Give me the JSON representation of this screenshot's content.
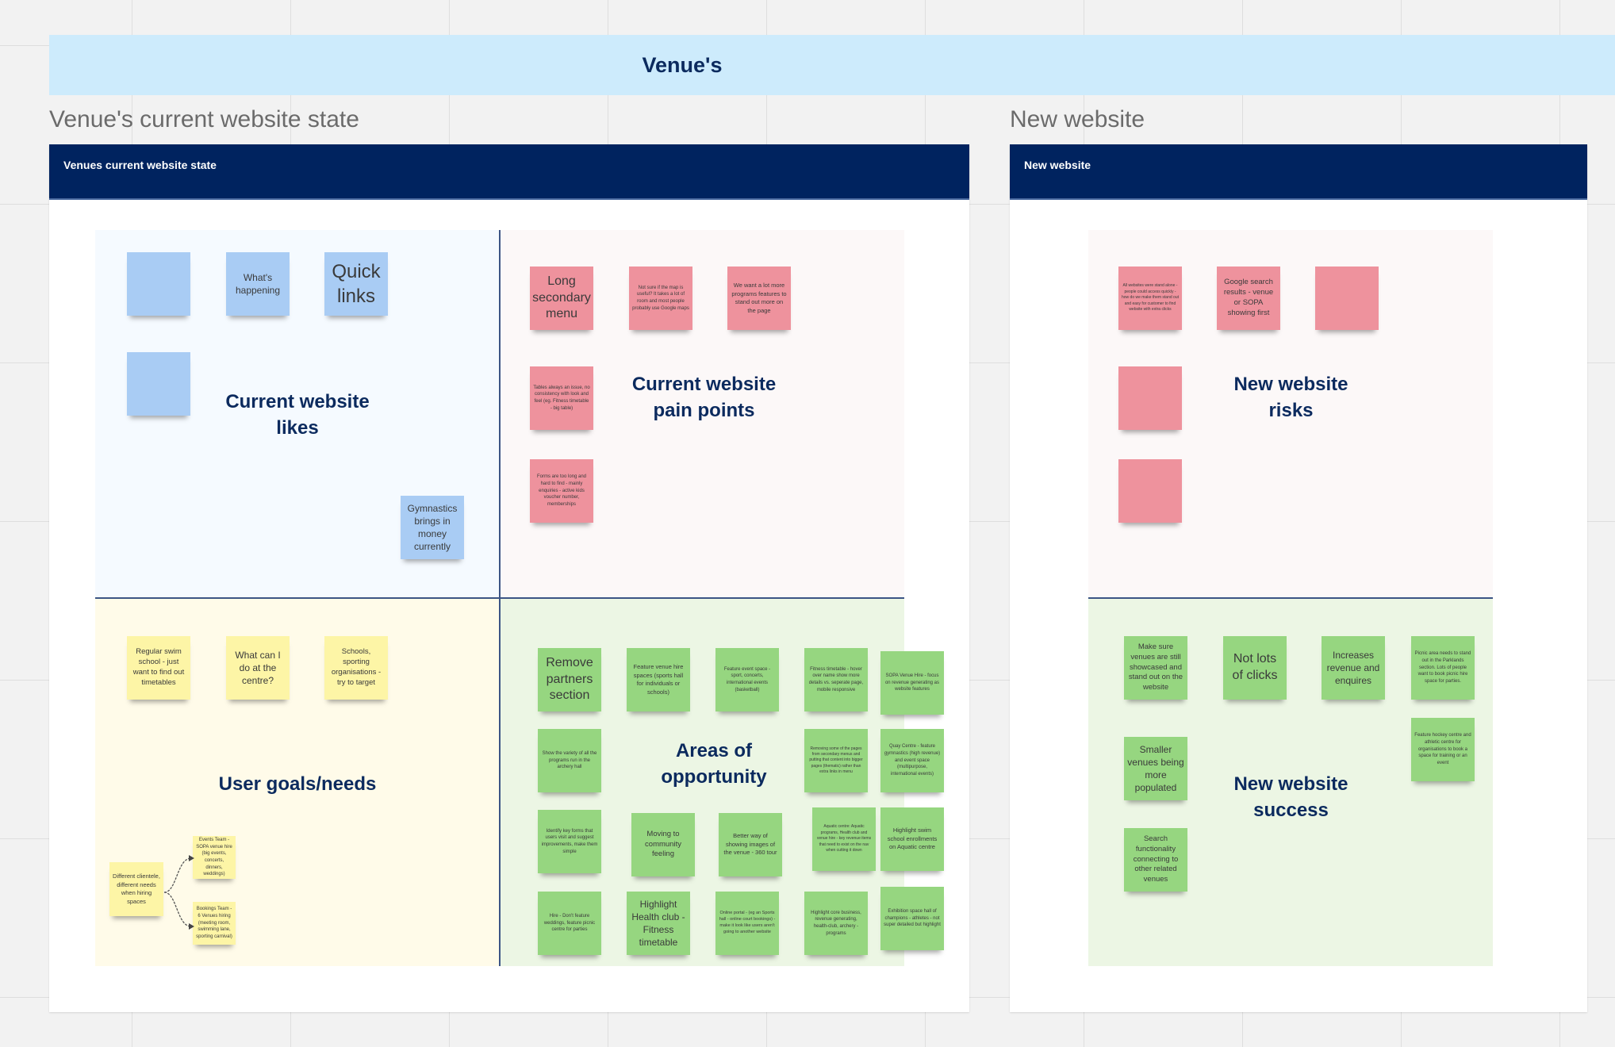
{
  "banner": {
    "title": "Venue's"
  },
  "colors": {
    "banner": "#cdebfc",
    "frame_header": "#00235f",
    "label_text": "#0b2a5e",
    "sticky_blue": "#a9ccf4",
    "sticky_pink": "#ee929d",
    "sticky_yellow": "#fdf5a6",
    "sticky_green": "#96d680"
  },
  "current_frame": {
    "title": "Venue's current website state",
    "header_label": "Venues current website state",
    "quadrants": {
      "likes": {
        "label": "Current website likes",
        "stickies": [
          "",
          "What's happening",
          "Quick links",
          "",
          "Gymnastics brings in money currently"
        ]
      },
      "pain_points": {
        "label": "Current website pain points",
        "stickies": [
          "Long secondary menu",
          "Not sure if the map is useful? It takes a lot of room and most people probably use Google maps",
          "We want a lot more programs features to stand out more on the page",
          "Tables always an issue, no consistency with look and feel (eg. Fitness timetable - big table)",
          "Forms are too long and hard to find - mainly enquiries - active kids voucher number, memberships"
        ]
      },
      "user_goals": {
        "label": "User goals/needs",
        "stickies": [
          "Regular swim school - just want to find out timetables",
          "What can I do at the centre?",
          "Schools, sporting organisations - try to target",
          "Different clientele, different needs when hiring spaces",
          "Events Team - SOPA venue hire (big events, concerts, dinners, weddings)",
          "Bookings Team - 6 Venues hiring (meeting room, swimming lane, sporting carnival)"
        ]
      },
      "opportunities": {
        "label": "Areas of opportunity",
        "stickies": [
          "Remove partners section",
          "Feature venue hire spaces (sports hall for individuals or schools)",
          "Feature event space - sport, concerts, international events (basketball)",
          "Fitness timetable - hover over name show more details vs. seperate page, mobile responsive",
          "SOPA Venue Hire - focus on revenue generating as website features",
          "Show the variety of all the programs run in the archery hall",
          "Removing some of the pages from secondary menus and putting that content into bigger pages (thematic) rather than extra links in menu",
          "Quay Centre - feature gymnastics (high revenue) and event space (multipurpose, international events)",
          "Identify key forms that users visit and suggest improvements, make them simple",
          "Moving to community feeling",
          "Better way of showing images of the venue - 360 tour",
          "Aquatic centre: Aquatic programs, Health club and venue hire - key revenue items that need to exist on the nav when cutting it down",
          "Highlight swim school enrollments on Aquatic centre",
          "Hire - Don't feature weddings, feature picnic centre for parties",
          "Highlight Health club - Fitness timetable",
          "Online portal - (eg an Sports hall - online court bookings) - make it look like users aren't going to another website",
          "Highlight core business, revenue generating, health-club, archery - programs",
          "Exhibition space hall of champions - athletes - not super detailed but highlight"
        ]
      }
    }
  },
  "new_frame": {
    "title": "New website",
    "header_label": "New website",
    "areas": {
      "risks": {
        "label": "New website risks",
        "stickies": [
          "All websites were stand alone - people could access quickly - how do we make them stand out and easy for customer to find website with extra clicks",
          "Google search results - venue or SOPA showing first",
          "",
          "",
          ""
        ]
      },
      "success": {
        "label": "New website success",
        "stickies": [
          "Make sure venues are still showcased and stand out on the website",
          "Not lots of clicks",
          "Increases revenue and enquires",
          "Picnic area needs to stand out in the Parklands section. Lots of people want to book picnic hire space for parties.",
          "Smaller venues being more populated",
          "Feature hockey centre and athletic centre for organisations to book a space for training or an event",
          "Search functionality connecting to other related venues"
        ]
      }
    }
  }
}
